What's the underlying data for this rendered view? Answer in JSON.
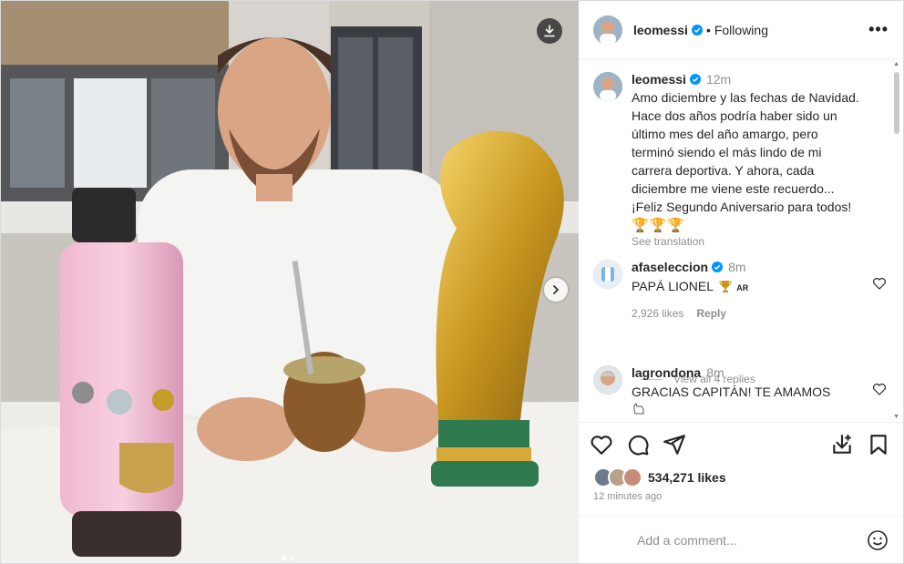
{
  "post": {
    "author": "leomessi",
    "follow_status": "Following",
    "more_label": "•••",
    "separator": "•"
  },
  "caption": {
    "username": "leomessi",
    "time": "12m",
    "text": "Amo diciembre y las fechas de Navidad.\nHace dos años podría haber sido un\núltimo mes del año amargo, pero\nterminó siendo el más lindo de mi\ncarrera deportiva. Y ahora, cada\ndiciembre me viene este recuerdo...\n¡Feliz Segundo Aniversario para todos!",
    "emoji": "🏆🏆🏆",
    "see_translation": "See translation"
  },
  "comments": [
    {
      "username": "afaseleccion",
      "time": "8m",
      "text": "PAPÁ LIONEL",
      "suffix": "AR",
      "likes": "2,926 likes",
      "reply": "Reply"
    },
    {
      "username": "lagrondona",
      "time": "8m",
      "text": "GRACIAS CAPITÁN! TE AMAMOS"
    }
  ],
  "view_replies": "View all 4 replies",
  "likes_count": "534,271 likes",
  "posted_ago": "12 minutes ago",
  "add_comment_placeholder": "Add a comment...",
  "icons": {
    "download": "download-icon",
    "next": "chevron-right-icon",
    "heart": "heart-icon",
    "comment": "comment-icon",
    "share": "share-icon",
    "save": "bookmark-icon",
    "verified": "verified-badge-icon",
    "emoji": "emoji-icon"
  },
  "colors": {
    "verified": "#0095f6",
    "secondary_text": "#8e8e8e"
  }
}
